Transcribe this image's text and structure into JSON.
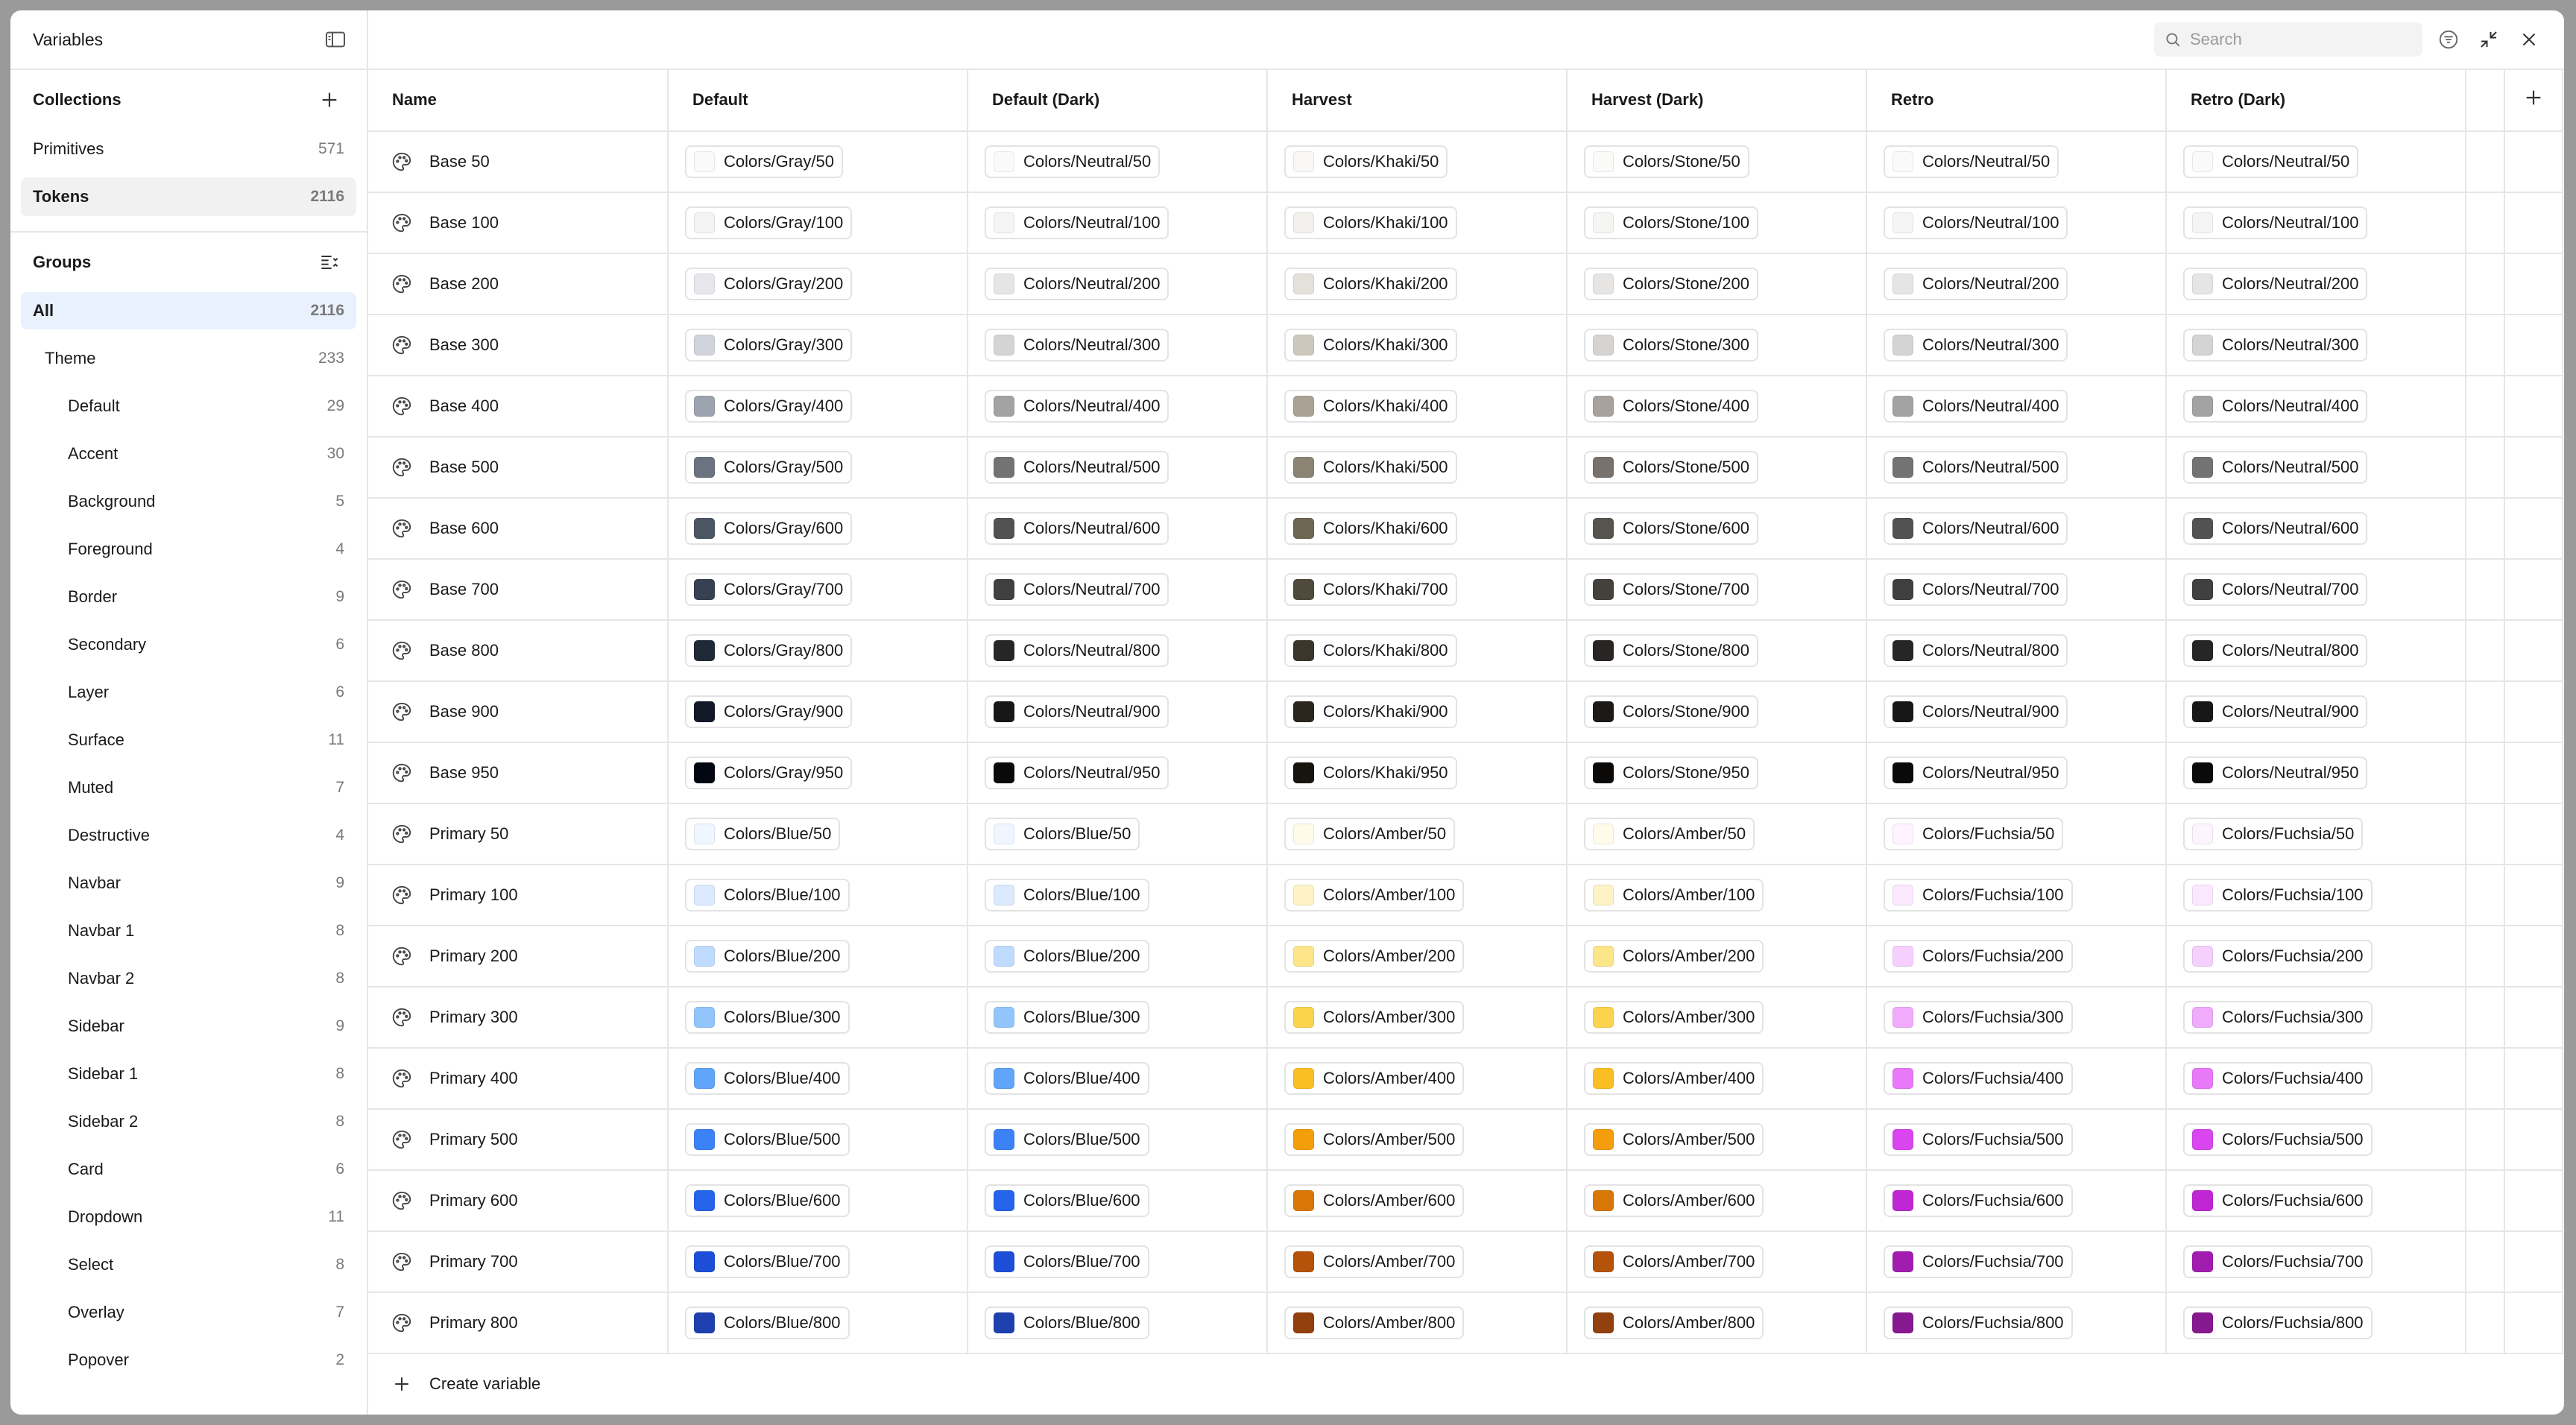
{
  "sidebar": {
    "title": "Variables",
    "collections_title": "Collections",
    "collections": [
      {
        "label": "Primitives",
        "count": "571"
      },
      {
        "label": "Tokens",
        "count": "2116"
      }
    ],
    "groups_title": "Groups",
    "groups": [
      {
        "label": "All",
        "count": "2116",
        "level": 0
      },
      {
        "label": "Theme",
        "count": "233",
        "level": 1
      },
      {
        "label": "Default",
        "count": "29",
        "level": 2
      },
      {
        "label": "Accent",
        "count": "30",
        "level": 2
      },
      {
        "label": "Background",
        "count": "5",
        "level": 2
      },
      {
        "label": "Foreground",
        "count": "4",
        "level": 2
      },
      {
        "label": "Border",
        "count": "9",
        "level": 2
      },
      {
        "label": "Secondary",
        "count": "6",
        "level": 2
      },
      {
        "label": "Layer",
        "count": "6",
        "level": 2
      },
      {
        "label": "Surface",
        "count": "11",
        "level": 2
      },
      {
        "label": "Muted",
        "count": "7",
        "level": 2
      },
      {
        "label": "Destructive",
        "count": "4",
        "level": 2
      },
      {
        "label": "Navbar",
        "count": "9",
        "level": 2
      },
      {
        "label": "Navbar 1",
        "count": "8",
        "level": 2
      },
      {
        "label": "Navbar 2",
        "count": "8",
        "level": 2
      },
      {
        "label": "Sidebar",
        "count": "9",
        "level": 2
      },
      {
        "label": "Sidebar 1",
        "count": "8",
        "level": 2
      },
      {
        "label": "Sidebar 2",
        "count": "8",
        "level": 2
      },
      {
        "label": "Card",
        "count": "6",
        "level": 2
      },
      {
        "label": "Dropdown",
        "count": "11",
        "level": 2
      },
      {
        "label": "Select",
        "count": "8",
        "level": 2
      },
      {
        "label": "Overlay",
        "count": "7",
        "level": 2
      },
      {
        "label": "Popover",
        "count": "2",
        "level": 2
      }
    ]
  },
  "search": {
    "placeholder": "Search"
  },
  "table": {
    "columns": [
      "Name",
      "Default",
      "Default (Dark)",
      "Harvest",
      "Harvest (Dark)",
      "Retro",
      "Retro (Dark)"
    ],
    "rows": [
      {
        "name": "Base 50",
        "values": [
          {
            "label": "Colors/Gray/50",
            "color": "#f9fafb"
          },
          {
            "label": "Colors/Neutral/50",
            "color": "#fafafa"
          },
          {
            "label": "Colors/Khaki/50",
            "color": "#f9f8f6"
          },
          {
            "label": "Colors/Stone/50",
            "color": "#fafaf9"
          },
          {
            "label": "Colors/Neutral/50",
            "color": "#fafafa"
          },
          {
            "label": "Colors/Neutral/50",
            "color": "#fafafa"
          }
        ]
      },
      {
        "name": "Base 100",
        "values": [
          {
            "label": "Colors/Gray/100",
            "color": "#f3f4f6"
          },
          {
            "label": "Colors/Neutral/100",
            "color": "#f5f5f5"
          },
          {
            "label": "Colors/Khaki/100",
            "color": "#f2f0ec"
          },
          {
            "label": "Colors/Stone/100",
            "color": "#f5f5f4"
          },
          {
            "label": "Colors/Neutral/100",
            "color": "#f5f5f5"
          },
          {
            "label": "Colors/Neutral/100",
            "color": "#f5f5f5"
          }
        ]
      },
      {
        "name": "Base 200",
        "values": [
          {
            "label": "Colors/Gray/200",
            "color": "#e5e7eb"
          },
          {
            "label": "Colors/Neutral/200",
            "color": "#e5e5e5"
          },
          {
            "label": "Colors/Khaki/200",
            "color": "#e4e1da"
          },
          {
            "label": "Colors/Stone/200",
            "color": "#e7e5e4"
          },
          {
            "label": "Colors/Neutral/200",
            "color": "#e5e5e5"
          },
          {
            "label": "Colors/Neutral/200",
            "color": "#e5e5e5"
          }
        ]
      },
      {
        "name": "Base 300",
        "values": [
          {
            "label": "Colors/Gray/300",
            "color": "#d1d5db"
          },
          {
            "label": "Colors/Neutral/300",
            "color": "#d4d4d4"
          },
          {
            "label": "Colors/Khaki/300",
            "color": "#cdc8bd"
          },
          {
            "label": "Colors/Stone/300",
            "color": "#d6d3d1"
          },
          {
            "label": "Colors/Neutral/300",
            "color": "#d4d4d4"
          },
          {
            "label": "Colors/Neutral/300",
            "color": "#d4d4d4"
          }
        ]
      },
      {
        "name": "Base 400",
        "values": [
          {
            "label": "Colors/Gray/400",
            "color": "#9ca3af"
          },
          {
            "label": "Colors/Neutral/400",
            "color": "#a3a3a3"
          },
          {
            "label": "Colors/Khaki/400",
            "color": "#aaa294"
          },
          {
            "label": "Colors/Stone/400",
            "color": "#a8a29e"
          },
          {
            "label": "Colors/Neutral/400",
            "color": "#a3a3a3"
          },
          {
            "label": "Colors/Neutral/400",
            "color": "#a3a3a3"
          }
        ]
      },
      {
        "name": "Base 500",
        "values": [
          {
            "label": "Colors/Gray/500",
            "color": "#6b7280"
          },
          {
            "label": "Colors/Neutral/500",
            "color": "#737373"
          },
          {
            "label": "Colors/Khaki/500",
            "color": "#8b8373"
          },
          {
            "label": "Colors/Stone/500",
            "color": "#78716c"
          },
          {
            "label": "Colors/Neutral/500",
            "color": "#737373"
          },
          {
            "label": "Colors/Neutral/500",
            "color": "#737373"
          }
        ]
      },
      {
        "name": "Base 600",
        "values": [
          {
            "label": "Colors/Gray/600",
            "color": "#4b5563"
          },
          {
            "label": "Colors/Neutral/600",
            "color": "#525252"
          },
          {
            "label": "Colors/Khaki/600",
            "color": "#6d6652"
          },
          {
            "label": "Colors/Stone/600",
            "color": "#57534e"
          },
          {
            "label": "Colors/Neutral/600",
            "color": "#525252"
          },
          {
            "label": "Colors/Neutral/600",
            "color": "#525252"
          }
        ]
      },
      {
        "name": "Base 700",
        "values": [
          {
            "label": "Colors/Gray/700",
            "color": "#374151"
          },
          {
            "label": "Colors/Neutral/700",
            "color": "#404040"
          },
          {
            "label": "Colors/Khaki/700",
            "color": "#504a3c"
          },
          {
            "label": "Colors/Stone/700",
            "color": "#44403c"
          },
          {
            "label": "Colors/Neutral/700",
            "color": "#404040"
          },
          {
            "label": "Colors/Neutral/700",
            "color": "#404040"
          }
        ]
      },
      {
        "name": "Base 800",
        "values": [
          {
            "label": "Colors/Gray/800",
            "color": "#1f2937"
          },
          {
            "label": "Colors/Neutral/800",
            "color": "#262626"
          },
          {
            "label": "Colors/Khaki/800",
            "color": "#3b362b"
          },
          {
            "label": "Colors/Stone/800",
            "color": "#292524"
          },
          {
            "label": "Colors/Neutral/800",
            "color": "#262626"
          },
          {
            "label": "Colors/Neutral/800",
            "color": "#262626"
          }
        ]
      },
      {
        "name": "Base 900",
        "values": [
          {
            "label": "Colors/Gray/900",
            "color": "#111827"
          },
          {
            "label": "Colors/Neutral/900",
            "color": "#171717"
          },
          {
            "label": "Colors/Khaki/900",
            "color": "#2a261e"
          },
          {
            "label": "Colors/Stone/900",
            "color": "#1c1917"
          },
          {
            "label": "Colors/Neutral/900",
            "color": "#171717"
          },
          {
            "label": "Colors/Neutral/900",
            "color": "#171717"
          }
        ]
      },
      {
        "name": "Base 950",
        "values": [
          {
            "label": "Colors/Gray/950",
            "color": "#030712"
          },
          {
            "label": "Colors/Neutral/950",
            "color": "#0a0a0a"
          },
          {
            "label": "Colors/Khaki/950",
            "color": "#17140e"
          },
          {
            "label": "Colors/Stone/950",
            "color": "#0c0a09"
          },
          {
            "label": "Colors/Neutral/950",
            "color": "#0a0a0a"
          },
          {
            "label": "Colors/Neutral/950",
            "color": "#0a0a0a"
          }
        ]
      },
      {
        "name": "Primary 50",
        "values": [
          {
            "label": "Colors/Blue/50",
            "color": "#eff6ff"
          },
          {
            "label": "Colors/Blue/50",
            "color": "#eff6ff"
          },
          {
            "label": "Colors/Amber/50",
            "color": "#fffbeb"
          },
          {
            "label": "Colors/Amber/50",
            "color": "#fffbeb"
          },
          {
            "label": "Colors/Fuchsia/50",
            "color": "#fdf4ff"
          },
          {
            "label": "Colors/Fuchsia/50",
            "color": "#fdf4ff"
          }
        ]
      },
      {
        "name": "Primary 100",
        "values": [
          {
            "label": "Colors/Blue/100",
            "color": "#dbeafe"
          },
          {
            "label": "Colors/Blue/100",
            "color": "#dbeafe"
          },
          {
            "label": "Colors/Amber/100",
            "color": "#fef3c7"
          },
          {
            "label": "Colors/Amber/100",
            "color": "#fef3c7"
          },
          {
            "label": "Colors/Fuchsia/100",
            "color": "#fae8ff"
          },
          {
            "label": "Colors/Fuchsia/100",
            "color": "#fae8ff"
          }
        ]
      },
      {
        "name": "Primary 200",
        "values": [
          {
            "label": "Colors/Blue/200",
            "color": "#bfdbfe"
          },
          {
            "label": "Colors/Blue/200",
            "color": "#bfdbfe"
          },
          {
            "label": "Colors/Amber/200",
            "color": "#fde68a"
          },
          {
            "label": "Colors/Amber/200",
            "color": "#fde68a"
          },
          {
            "label": "Colors/Fuchsia/200",
            "color": "#f5d0fe"
          },
          {
            "label": "Colors/Fuchsia/200",
            "color": "#f5d0fe"
          }
        ]
      },
      {
        "name": "Primary 300",
        "values": [
          {
            "label": "Colors/Blue/300",
            "color": "#93c5fd"
          },
          {
            "label": "Colors/Blue/300",
            "color": "#93c5fd"
          },
          {
            "label": "Colors/Amber/300",
            "color": "#fcd34d"
          },
          {
            "label": "Colors/Amber/300",
            "color": "#fcd34d"
          },
          {
            "label": "Colors/Fuchsia/300",
            "color": "#f0abfc"
          },
          {
            "label": "Colors/Fuchsia/300",
            "color": "#f0abfc"
          }
        ]
      },
      {
        "name": "Primary 400",
        "values": [
          {
            "label": "Colors/Blue/400",
            "color": "#60a5fa"
          },
          {
            "label": "Colors/Blue/400",
            "color": "#60a5fa"
          },
          {
            "label": "Colors/Amber/400",
            "color": "#fbbf24"
          },
          {
            "label": "Colors/Amber/400",
            "color": "#fbbf24"
          },
          {
            "label": "Colors/Fuchsia/400",
            "color": "#e879f9"
          },
          {
            "label": "Colors/Fuchsia/400",
            "color": "#e879f9"
          }
        ]
      },
      {
        "name": "Primary 500",
        "values": [
          {
            "label": "Colors/Blue/500",
            "color": "#3b82f6"
          },
          {
            "label": "Colors/Blue/500",
            "color": "#3b82f6"
          },
          {
            "label": "Colors/Amber/500",
            "color": "#f59e0b"
          },
          {
            "label": "Colors/Amber/500",
            "color": "#f59e0b"
          },
          {
            "label": "Colors/Fuchsia/500",
            "color": "#d946ef"
          },
          {
            "label": "Colors/Fuchsia/500",
            "color": "#d946ef"
          }
        ]
      },
      {
        "name": "Primary 600",
        "values": [
          {
            "label": "Colors/Blue/600",
            "color": "#2563eb"
          },
          {
            "label": "Colors/Blue/600",
            "color": "#2563eb"
          },
          {
            "label": "Colors/Amber/600",
            "color": "#d97706"
          },
          {
            "label": "Colors/Amber/600",
            "color": "#d97706"
          },
          {
            "label": "Colors/Fuchsia/600",
            "color": "#c026d3"
          },
          {
            "label": "Colors/Fuchsia/600",
            "color": "#c026d3"
          }
        ]
      },
      {
        "name": "Primary 700",
        "values": [
          {
            "label": "Colors/Blue/700",
            "color": "#1d4ed8"
          },
          {
            "label": "Colors/Blue/700",
            "color": "#1d4ed8"
          },
          {
            "label": "Colors/Amber/700",
            "color": "#b45309"
          },
          {
            "label": "Colors/Amber/700",
            "color": "#b45309"
          },
          {
            "label": "Colors/Fuchsia/700",
            "color": "#a21caf"
          },
          {
            "label": "Colors/Fuchsia/700",
            "color": "#a21caf"
          }
        ]
      },
      {
        "name": "Primary 800",
        "values": [
          {
            "label": "Colors/Blue/800",
            "color": "#1e40af"
          },
          {
            "label": "Colors/Blue/800",
            "color": "#1e40af"
          },
          {
            "label": "Colors/Amber/800",
            "color": "#92400e"
          },
          {
            "label": "Colors/Amber/800",
            "color": "#92400e"
          },
          {
            "label": "Colors/Fuchsia/800",
            "color": "#86198f"
          },
          {
            "label": "Colors/Fuchsia/800",
            "color": "#86198f"
          }
        ]
      }
    ]
  },
  "footer": {
    "create_label": "Create variable"
  },
  "icons": {
    "row": "palette-icon"
  }
}
